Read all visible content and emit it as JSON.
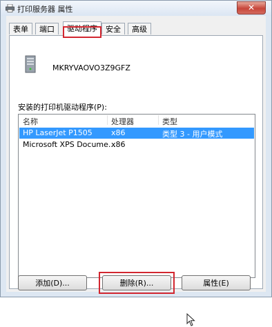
{
  "window": {
    "title": "打印服务器 属性",
    "close_glyph": "✕"
  },
  "tabs": [
    {
      "label": "表单",
      "active": false
    },
    {
      "label": "端口",
      "active": false
    },
    {
      "label": "驱动程序",
      "active": true
    },
    {
      "label": "安全",
      "active": false
    },
    {
      "label": "高级",
      "active": false
    }
  ],
  "server": {
    "icon": "server-icon",
    "name": "MKRYVAOVO3Z9GFZ"
  },
  "drivers": {
    "label": "安装的打印机驱动程序(P):",
    "columns": [
      "名称",
      "处理器",
      "类型"
    ],
    "rows": [
      {
        "name": "HP LaserJet P1505",
        "processor": "x86",
        "type": "类型 3 - 用户模式",
        "selected": true
      },
      {
        "name": "Microsoft XPS Docume...",
        "processor": "x86",
        "type": "",
        "selected": false
      }
    ]
  },
  "buttons": {
    "add": "添加(D)...",
    "remove": "删除(R)...",
    "properties": "属性(E)"
  },
  "colors": {
    "selection": "#3399ff",
    "highlight_annotation": "#d2262f"
  }
}
